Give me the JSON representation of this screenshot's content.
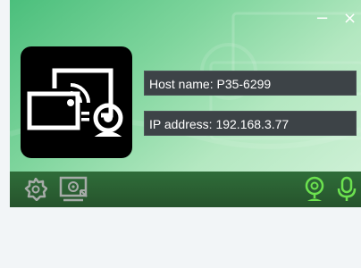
{
  "window": {
    "minimize_symbol": "−",
    "close_symbol": "×"
  },
  "logo": {
    "icon": "screen-cast-camera-logo"
  },
  "info": {
    "host_name": "Host name: P35-6299",
    "ip_address": "IP address: 192.168.3.77"
  },
  "toolbar": {
    "left_icons": [
      "settings-icon",
      "screen-cast-icon"
    ],
    "right_icons": [
      "webcam-icon",
      "microphone-icon"
    ]
  },
  "colors": {
    "header_green": "#4bbf7c",
    "toolbar_green": "#2f6d39",
    "active_icon": "#6ce24f",
    "muted_icon": "#a6aca8",
    "field_bg": "#3d4347"
  }
}
